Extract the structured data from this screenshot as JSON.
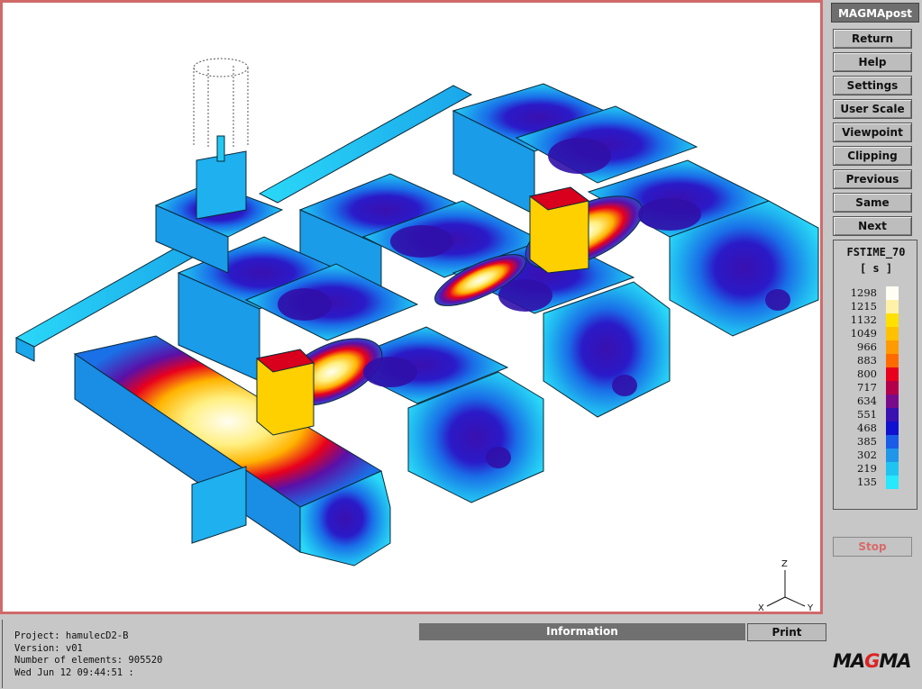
{
  "app": {
    "title": "MAGMApost"
  },
  "menu": {
    "buttons": [
      "Return",
      "Help",
      "Settings",
      "User Scale",
      "Viewpoint",
      "Clipping",
      "Previous",
      "Same",
      "Next"
    ],
    "stop_label": "Stop"
  },
  "legend": {
    "title": "FSTIME_70",
    "unit": "[ s ]",
    "values": [
      "1298",
      "1215",
      "1132",
      "1049",
      "966",
      "883",
      "800",
      "717",
      "634",
      "551",
      "468",
      "385",
      "302",
      "219",
      "135"
    ],
    "colors": [
      "#fffef5",
      "#fff2a8",
      "#ffe000",
      "#ffc000",
      "#ff9a00",
      "#ff6a00",
      "#e8001c",
      "#b4004a",
      "#7a0a8c",
      "#3a10b0",
      "#1010d0",
      "#1a5ce8",
      "#1f96e8",
      "#20c4f0",
      "#26e8ff"
    ]
  },
  "axes": {
    "z": "Z",
    "x": "X",
    "y": "Y"
  },
  "project_info": {
    "project": "Project:  hamulecD2-B",
    "version": "Version: v01",
    "elements": "Number of elements:  905520",
    "date": "Wed Jun 12 09:44:51 :"
  },
  "bottom": {
    "information_label": "Information",
    "print_label": "Print"
  },
  "logo": {
    "pre": "MA",
    "accent": "G",
    "post": "MA"
  }
}
